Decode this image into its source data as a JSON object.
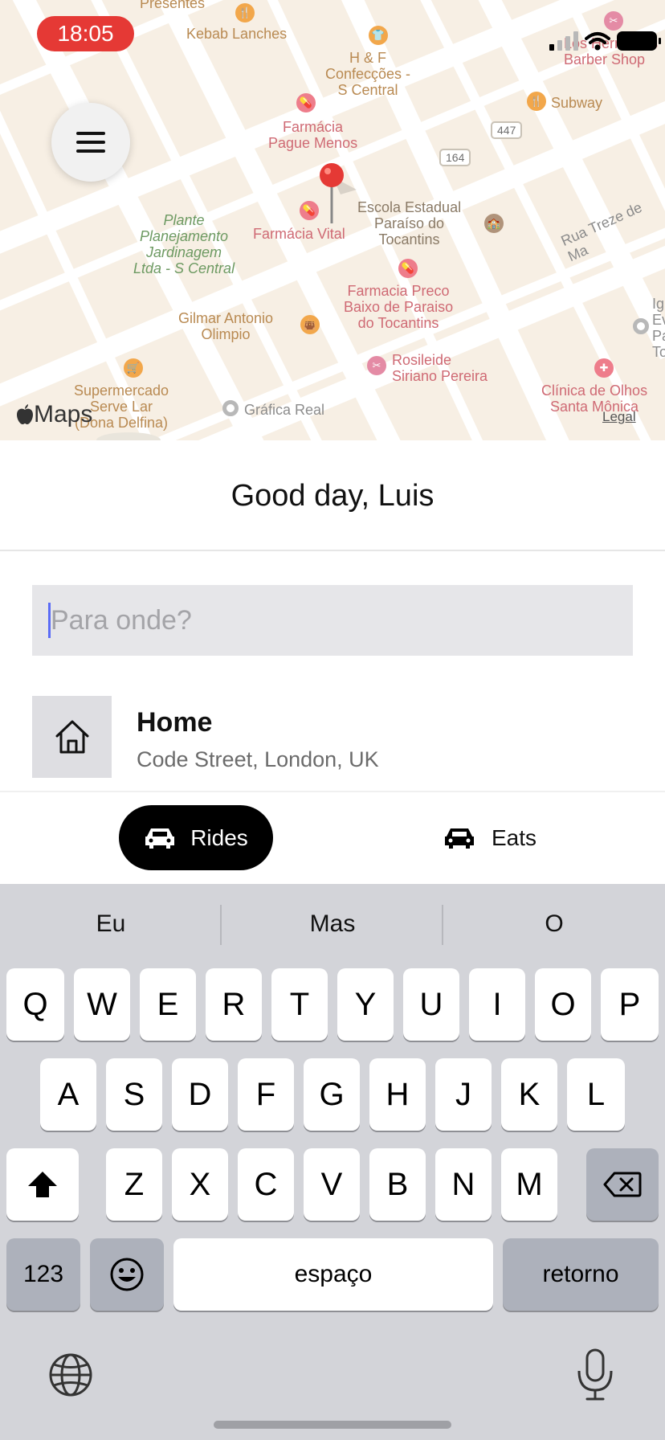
{
  "status_bar": {
    "time": "18:05"
  },
  "map": {
    "logo_text": "Maps",
    "legal": "Legal",
    "pois": {
      "presentes": "Presentes",
      "kebab": "Kebab Lanches",
      "hf": [
        "H & F",
        "Confecções -",
        "S Central"
      ],
      "barber": [
        "Los Hermanos",
        "Barber Shop"
      ],
      "subway": "Subway",
      "farmacia_pague": [
        "Farmácia",
        "Pague Menos"
      ],
      "plante": [
        "Plante",
        "Planejamento",
        "Jardinagem",
        "Ltda - S Central"
      ],
      "farmacia_vital": "Farmácia Vital",
      "escola": [
        "Escola Estadual",
        "Paraíso do",
        "Tocantins"
      ],
      "farmacia_preco": [
        "Farmacia Preco",
        "Baixo de Paraiso",
        "do Tocantins"
      ],
      "gilmar": [
        "Gilmar Antonio",
        "Olimpio"
      ],
      "rosileide": [
        "Rosileide",
        "Siriano Pereira"
      ],
      "supermercado": [
        "Supermercado",
        "Serve Lar",
        "(Dona Delfina)"
      ],
      "grafica": "Gráfica Real",
      "clinica": [
        "Clínica de Olhos",
        "Santa Mônica"
      ],
      "edge_poi": [
        "Ig",
        "Ev",
        "Pa",
        "To"
      ]
    },
    "roads": {
      "badge_447": "447",
      "badge_164": "164",
      "rua": "Rua Treze de Ma"
    }
  },
  "greeting": "Good day, Luis",
  "search": {
    "placeholder": "Para onde?",
    "value": ""
  },
  "saved_place": {
    "title": "Home",
    "subtitle": "Code Street, London, UK"
  },
  "tabs": [
    {
      "label": "Rides",
      "active": true
    },
    {
      "label": "Eats",
      "active": false
    }
  ],
  "keyboard": {
    "suggestions": [
      "Eu",
      "Mas",
      "O"
    ],
    "row1": [
      "Q",
      "W",
      "E",
      "R",
      "T",
      "Y",
      "U",
      "I",
      "O",
      "P"
    ],
    "row2": [
      "A",
      "S",
      "D",
      "F",
      "G",
      "H",
      "J",
      "K",
      "L"
    ],
    "row3": [
      "Z",
      "X",
      "C",
      "V",
      "B",
      "N",
      "M"
    ],
    "numbers_key": "123",
    "space_key": "espaço",
    "return_key": "retorno"
  },
  "colors": {
    "time_pill": "#e53935",
    "accent_caret": "#5b6cf6",
    "active_tab": "#000000"
  }
}
